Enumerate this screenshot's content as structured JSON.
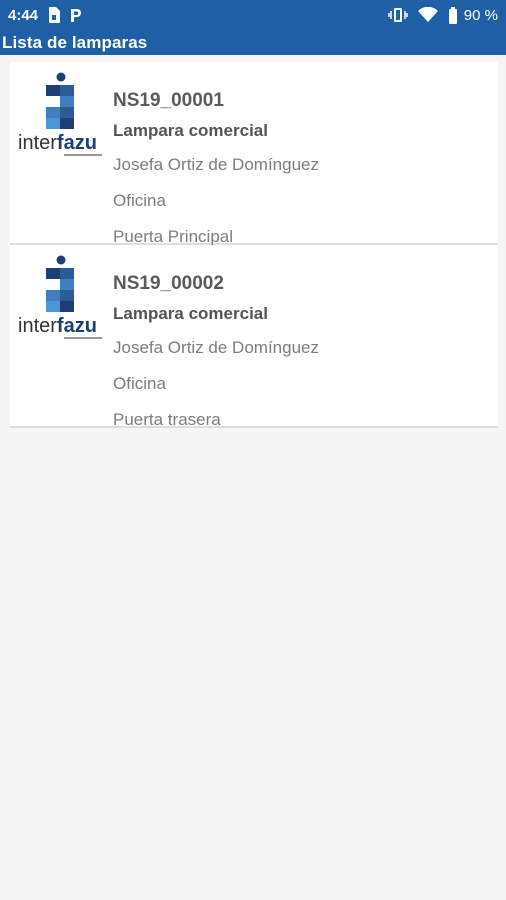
{
  "status_bar": {
    "time": "4:44",
    "battery_percent": "90 %",
    "icons": [
      "sim-card-icon",
      "parking-icon",
      "vibrate-icon",
      "wifi-icon",
      "battery-icon"
    ]
  },
  "app_bar": {
    "title": "Lista de lamparas"
  },
  "colors": {
    "primary": "#1f5fa6",
    "logo_dark": "#1d3f77",
    "logo_light": "#4b97d6"
  },
  "lamps": [
    {
      "logo_text_a": "inter",
      "logo_text_b": "fazu",
      "serial": "NS19_00001",
      "model": "Lampara comercial",
      "owner": "Josefa Ortiz de Domínguez",
      "area": "Oficina",
      "location": "Puerta Principal"
    },
    {
      "logo_text_a": "inter",
      "logo_text_b": "fazu",
      "serial": "NS19_00002",
      "model": "Lampara comercial",
      "owner": "Josefa Ortiz de Domínguez",
      "area": "Oficina",
      "location": "Puerta trasera"
    }
  ]
}
